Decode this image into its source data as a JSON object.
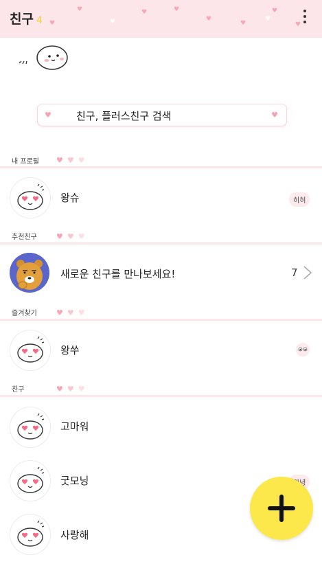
{
  "header": {
    "title": "친구",
    "count": "4"
  },
  "search": {
    "placeholder": "친구, 플러스친구 검색"
  },
  "sections": {
    "my_profile": "내 프로필",
    "recommended": "추천친구",
    "favorites": "즐겨찾기",
    "friends": "친구"
  },
  "my_profile": {
    "name": "왕슈",
    "status": "히히"
  },
  "recommended": {
    "text": "새로운 친구를 만나보세요!",
    "count": "7"
  },
  "favorites": [
    {
      "name": "왕쑤"
    }
  ],
  "friends": [
    {
      "name": "고마워"
    },
    {
      "name": "굿모닝",
      "status": "안녕"
    },
    {
      "name": "사랑해"
    }
  ],
  "colors": {
    "header_bg": "#fde6e9",
    "accent_pink": "#f7a6b6",
    "fab_yellow": "#fde84c",
    "count_yellow": "#f3d133"
  },
  "icons": {
    "menu": "more-vertical-icon",
    "add": "plus-icon",
    "chevron": "chevron-right-icon"
  }
}
